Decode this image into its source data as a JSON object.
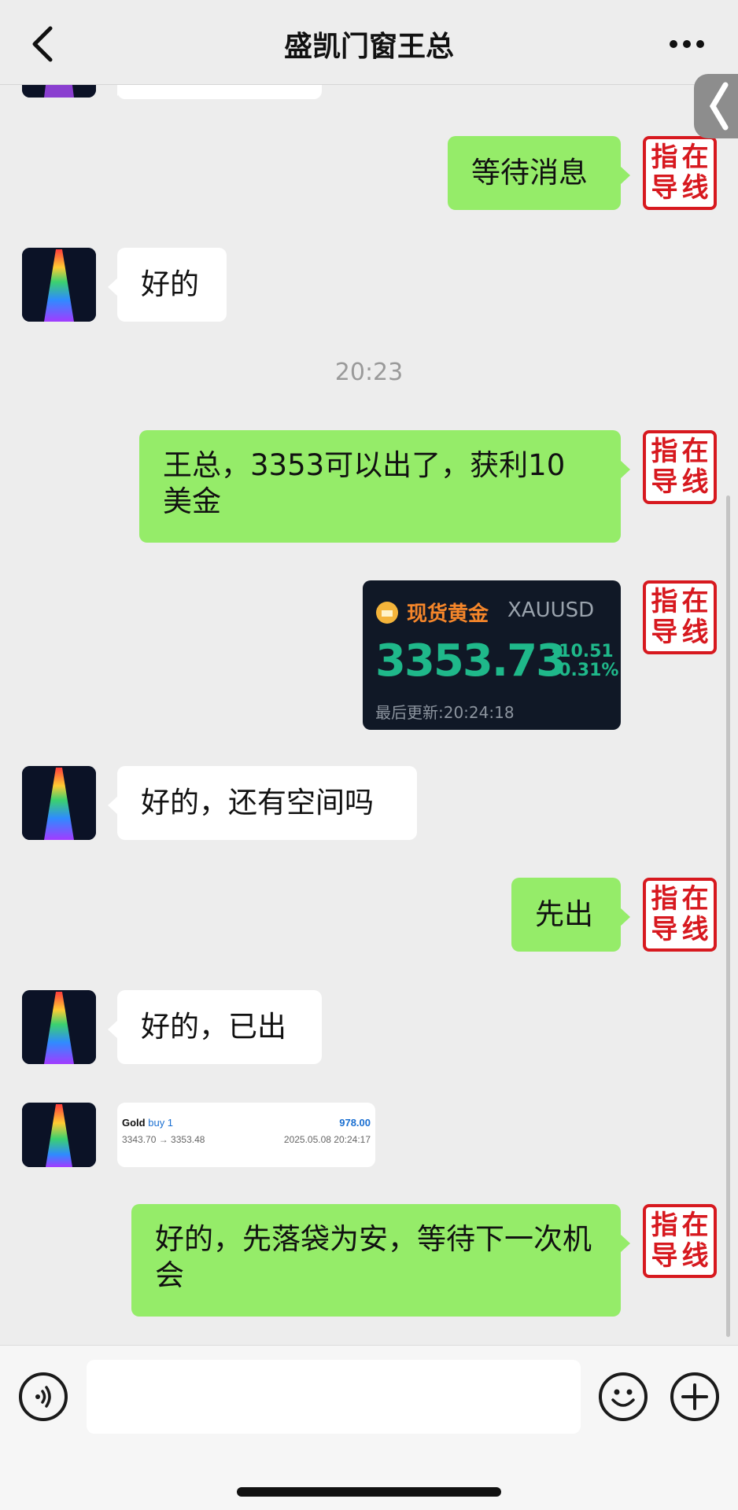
{
  "header": {
    "title": "盛凯门窗王总",
    "back_icon": "chevron-left-icon",
    "more_icon": "more-dots-icon"
  },
  "seal_chars": [
    "指",
    "在",
    "导",
    "线"
  ],
  "messages": {
    "m1": "等待消息",
    "m2": "好的",
    "m3": "王总，3353可以出了，获利10美金",
    "m4": "好的，还有空间吗",
    "m5": "先出",
    "m6": "好的，已出",
    "m7": "好的，先落袋为安，等待下一次机会"
  },
  "timestamp": "20:23",
  "quote": {
    "name": "现货黄金",
    "code": "XAUUSD",
    "price": "3353.73",
    "change": "-10.51",
    "change_pct": "-0.31%",
    "updated": "最后更新:20:24:18",
    "icon": "gold-coin-icon"
  },
  "trade": {
    "symbol": "Gold",
    "side": "buy 1",
    "profit": "978.00",
    "prices": "3343.70 → 3353.48",
    "time": "2025.05.08 20:24:17"
  },
  "input_bar": {
    "voice_icon": "voice-icon",
    "emoji_icon": "emoji-icon",
    "plus_icon": "plus-icon"
  },
  "colors": {
    "outgoing_bubble": "#95ec69",
    "incoming_bubble": "#ffffff",
    "seal_red": "#d7191f",
    "quote_green": "#1fb88a",
    "quote_orange": "#f5862a",
    "trade_blue": "#1a6fd1"
  }
}
